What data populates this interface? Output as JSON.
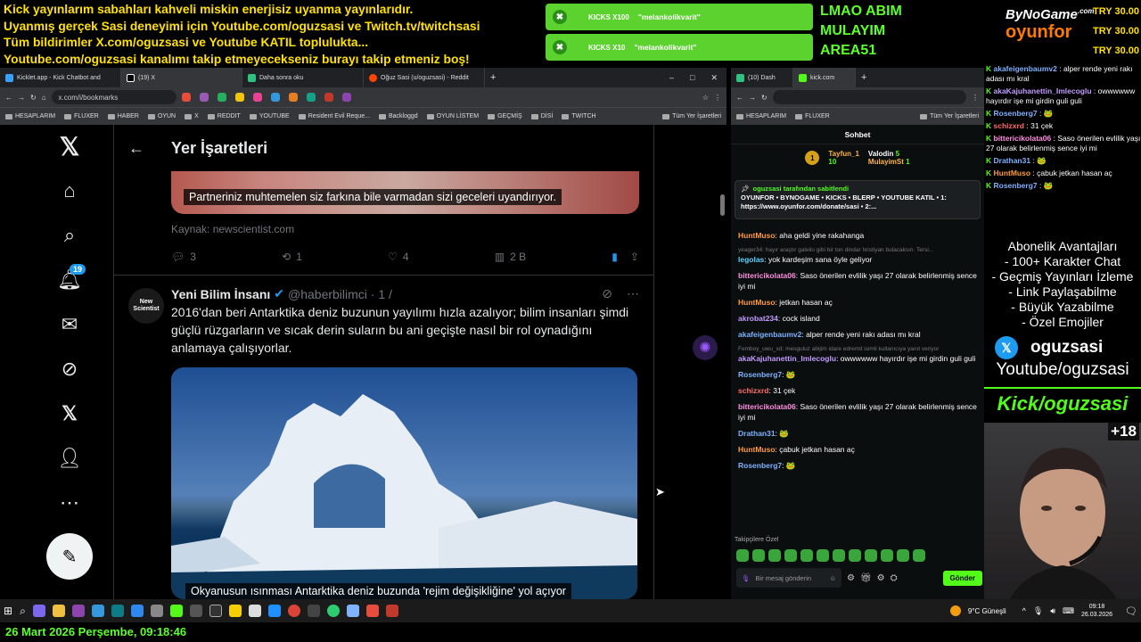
{
  "ticker": [
    "Kick yayınlarım sabahları kahveli miskin enerjisiz uyanma yayınlarıdır.",
    "Uyanmış gerçek Sasi deneyimi için Youtube.com/oguzsasi ve Twitch.tv/twitchsasi",
    "Tüm bildirimler X.com/oguzsasi ve Youtube KATIL toplulukta...",
    "Youtube.com/oguzsasi kanalımı takip etmeyecekseniz burayı takip etmeniz boş!"
  ],
  "alerts": [
    {
      "kind": "KICKS X100",
      "msg": "\"melankolikvarit\""
    },
    {
      "kind": "KICKS X10",
      "msg": "\"melankolikvarit\""
    }
  ],
  "green_title": [
    "LMAO ABIM",
    "MULAYIM",
    "AREA51"
  ],
  "brand": {
    "top": "ByNoGame",
    "top_small": ".com",
    "bottom": "oyunfor"
  },
  "try": [
    "TRY 30.00",
    "TRY 30.00",
    "TRY 30.00"
  ],
  "left_browser": {
    "tabs": [
      "Kicklet.app - Kick Chatbot and",
      "(19) X",
      "Daha sonra oku",
      "Oğuz Sasi (u/oguzsasi) - Reddit"
    ],
    "url": "x.com/i/bookmarks",
    "bookmarks": [
      "HESAPLARIM",
      "FLUXER",
      "HABER",
      "OYUN",
      "X",
      "REDDIT",
      "YOUTUBE",
      "Resident Evil Reque...",
      "Backloggd",
      "OYUN LİSTEM",
      "GEÇMİŞ",
      "DİSİ",
      "TWITCH",
      "Tüm Yer İşaretleri"
    ]
  },
  "x": {
    "header": "Yer İşaretleri",
    "notif_count": "19",
    "post1": {
      "image_caption": "Partneriniz muhtemelen siz farkına bile varmadan sizi geceleri uyandırıyor.",
      "source": "Kaynak: newscientist.com",
      "replies": "3",
      "reposts": "1",
      "likes": "4",
      "views": "2 B"
    },
    "post2": {
      "avatar_text": "New Scientist",
      "name": "Yeni Bilim İnsanı",
      "handle": "@haberbilimci · 1 /",
      "text": "2016'dan beri Antarktika deniz buzunun yayılımı hızla azalıyor; bilim insanları şimdi güçlü rüzgarların ve sıcak derin suların bu ani geçişte nasıl bir rol oynadığını anlamaya çalışıyorlar.",
      "image_caption": "Okyanusun ısınması Antarktika deniz buzunda 'rejim değişikliğine' yol açıyor"
    }
  },
  "right_browser": {
    "tabs": [
      "(10) Dash",
      "kick.com"
    ],
    "bookmarks": [
      "HESAPLARIM",
      "FLUXER",
      "Tüm Yer İşaretleri"
    ]
  },
  "kick_chat": {
    "title": "Sohbet",
    "leaders": [
      {
        "rank": "1",
        "name": "Tayfun_1",
        "n": "10"
      },
      {
        "name": "Valodin",
        "n": "5"
      },
      {
        "name": "MulayimSt",
        "n": "1"
      }
    ],
    "pinned_by": "oguzsasi tarafından sabitlendi",
    "pinned_text": "OYUNFOR • BYNOGAME • KICKS • BLERP • YOUTUBE KATIL • 1: https://www.oyunfor.com/donate/sasi • 2:...",
    "messages": [
      {
        "user": "HuntMuso",
        "color": "#ff9b3d",
        "text": "aha geldi yine rakahanga"
      },
      {
        "reply": "yeager34: hayır araştır galelio gibi bir ton dindar hristiyan bulacaksın. Tersi...",
        "user": "legolas",
        "color": "#5ad1ff",
        "text": "yok kardeşim sana öyle geliyor"
      },
      {
        "user": "bittericikolata06",
        "color": "#ff8fe0",
        "text": "Saso önerilen evlilik yaşı 27 olarak belirlenmiş sence iyi mi"
      },
      {
        "user": "HuntMuso",
        "color": "#ff9b3d",
        "text": "jetkan hasan aç"
      },
      {
        "user": "akrobat234",
        "color": "#c49bff",
        "text": "cock island"
      },
      {
        "user": "akafeigenbaumv2",
        "color": "#7fb2ff",
        "text": "alper rende yeni rakı adası mı kral"
      },
      {
        "reply": "Femboy_uwu_xd: mesguluz abijim idare edremit isimli kullanıcıya yanıt veriyor",
        "user": "akaKajuhanettin_Imlecoglu",
        "color": "#c49bff",
        "text": "owwwwww hayırdır işe mi girdin guli guli"
      },
      {
        "user": "Rosenberg7",
        "color": "#7fb2ff",
        "text": "🐸"
      },
      {
        "user": "schizxrd",
        "color": "#ff6b6b",
        "text": "31 çek"
      },
      {
        "user": "bittericikolata06",
        "color": "#ff8fe0",
        "text": "Saso önerilen evlilik yaşı 27 olarak belirlenmiş sence iyi mi"
      },
      {
        "user": "Drathan31",
        "color": "#7fb2ff",
        "text": "🐸"
      },
      {
        "user": "HuntMuso",
        "color": "#ff9b3d",
        "text": "çabuk jetkan hasan aç"
      },
      {
        "user": "Rosenberg7",
        "color": "#7fb2ff",
        "text": "🐸"
      }
    ],
    "emote_label": "Takipçilere Özel",
    "input_placeholder": "Bir mesaj gönderin",
    "send": "Gönder"
  },
  "overlay_chat": [
    {
      "user": "akafeigenbaumv2",
      "color": "#7fb2ff",
      "text": "alper rende yeni rakı adası mı kral"
    },
    {
      "user": "akaKajuhanettin_Imlecoglu",
      "color": "#c49bff",
      "text": "owwwwww hayırdır işe mi girdin guli guli"
    },
    {
      "user": "Rosenberg7",
      "color": "#7fb2ff",
      "text": "🐸"
    },
    {
      "user": "schizxrd",
      "color": "#ff6b6b",
      "text": "31 çek"
    },
    {
      "user": "bittericikolata06",
      "color": "#ff8fe0",
      "text": "Saso önerilen evlilik yaşı 27 olarak belirlenmiş sence iyi mi"
    },
    {
      "user": "Drathan31",
      "color": "#7fb2ff",
      "text": "🐸"
    },
    {
      "user": "HuntMuso",
      "color": "#ff9b3d",
      "text": "çabuk jetkan hasan aç"
    },
    {
      "user": "Rosenberg7",
      "color": "#7fb2ff",
      "text": "🐸"
    }
  ],
  "perks": {
    "title": "Abonelik Avantajları",
    "items": [
      "- 100+ Karakter Chat",
      "- Geçmiş Yayınları İzleme",
      "- Link Paylaşabilme",
      "- Büyük Yazabilme",
      "- Özel Emojiler"
    ]
  },
  "socials": {
    "x": "oguzsasi",
    "youtube": "Youtube/oguzsasi",
    "kick": "Kick/oguzsasi"
  },
  "age": "+18",
  "taskbar": {
    "weather": "9°C  Güneşli",
    "time": "09:18",
    "date": "26.03.2026"
  },
  "datebar": "26 Mart 2026 Perşembe, 09:18:46",
  "colors": {
    "kick_green": "#53fc18",
    "x_blue": "#1d9bf0",
    "ticker_yellow": "#ffe100"
  }
}
